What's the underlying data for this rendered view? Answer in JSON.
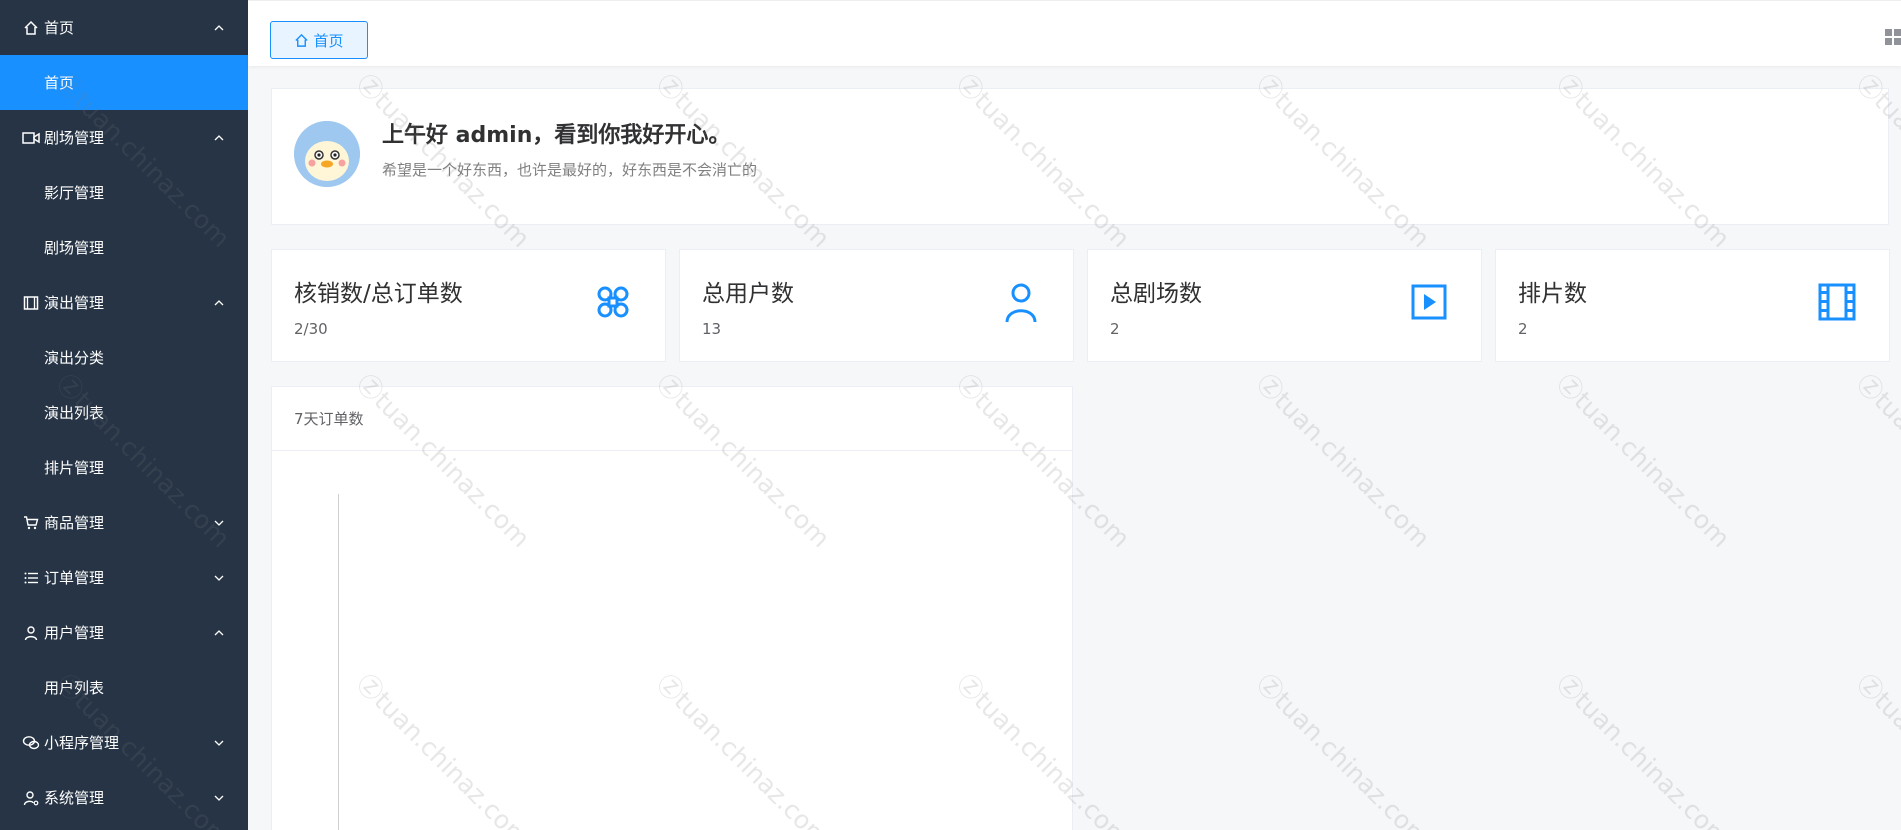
{
  "sidebar": {
    "items": [
      {
        "label": "首页",
        "icon": "home-icon",
        "chevron": "up"
      },
      {
        "label": "首页",
        "sub": true,
        "active": true
      },
      {
        "label": "剧场管理",
        "icon": "video-camera-icon",
        "chevron": "up"
      },
      {
        "label": "影厅管理",
        "sub": true
      },
      {
        "label": "剧场管理",
        "sub": true
      },
      {
        "label": "演出管理",
        "icon": "film-icon",
        "chevron": "up"
      },
      {
        "label": "演出分类",
        "sub": true
      },
      {
        "label": "演出列表",
        "sub": true
      },
      {
        "label": "排片管理",
        "sub": true
      },
      {
        "label": "商品管理",
        "icon": "cart-icon",
        "chevron": "down"
      },
      {
        "label": "订单管理",
        "icon": "list-icon",
        "chevron": "down"
      },
      {
        "label": "用户管理",
        "icon": "user-icon",
        "chevron": "up"
      },
      {
        "label": "用户列表",
        "sub": true
      },
      {
        "label": "小程序管理",
        "icon": "chat-icon",
        "chevron": "down"
      },
      {
        "label": "系统管理",
        "icon": "user-settings-icon",
        "chevron": "down"
      }
    ]
  },
  "topbar": {
    "tab_label": "首页",
    "tab_icon": "home-icon",
    "right_icon": "grid-icon"
  },
  "welcome": {
    "greeting": "上午好 admin，看到你我好开心。",
    "motto": "希望是一个好东西，也许是最好的，好东西是不会消亡的"
  },
  "stats": [
    {
      "title": "核销数/总订单数",
      "value": "2/30",
      "icon": "command-icon"
    },
    {
      "title": "总用户数",
      "value": "13",
      "icon": "user-icon"
    },
    {
      "title": "总剧场数",
      "value": "2",
      "icon": "play-square-icon"
    },
    {
      "title": "排片数",
      "value": "2",
      "icon": "film-strip-icon"
    }
  ],
  "chart": {
    "title": "7天订单数"
  },
  "watermark": "tuan.chinaz.com",
  "colors": {
    "sidebar_bg": "#263445",
    "accent": "#1890ff",
    "page_bg": "#f5f7f9"
  }
}
